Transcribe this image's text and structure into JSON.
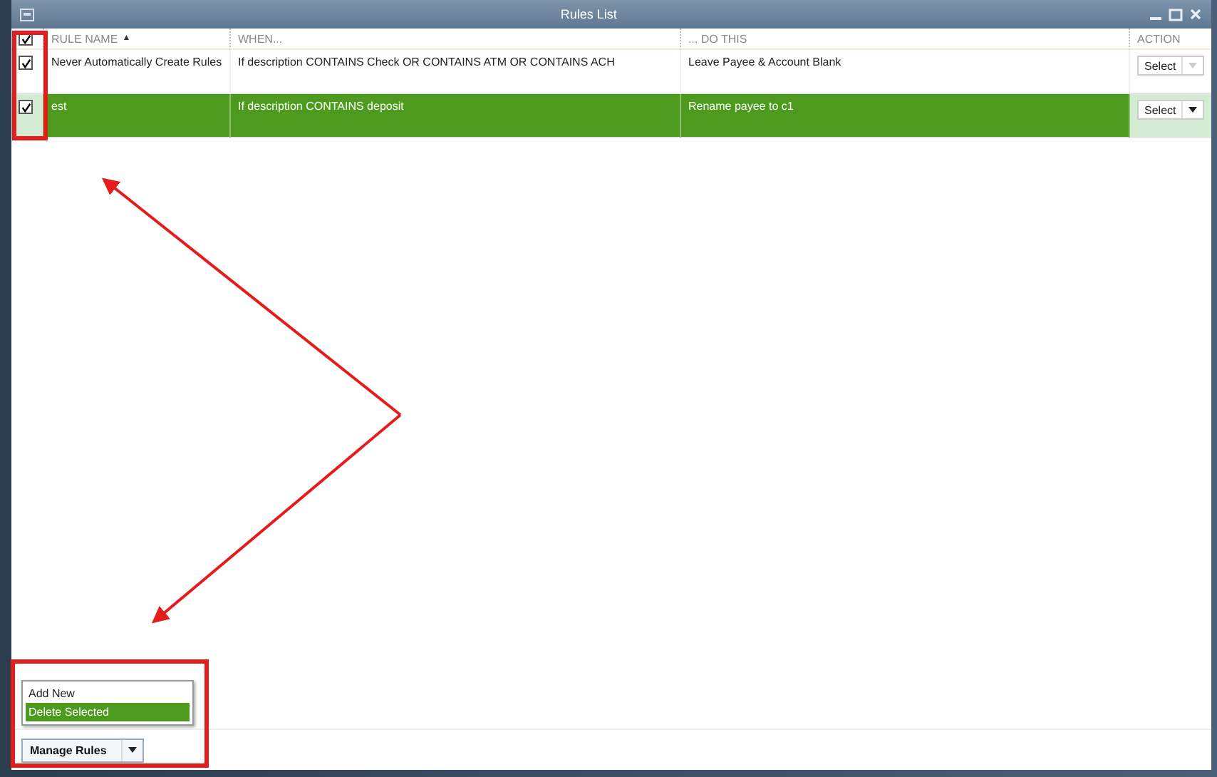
{
  "window": {
    "title": "Rules List"
  },
  "table": {
    "select_all": {
      "checked": true
    },
    "columns": [
      {
        "label": "RULE NAME",
        "sort_indicator": "▲"
      },
      {
        "label": "WHEN..."
      },
      {
        "label": "... DO THIS"
      },
      {
        "label": "ACTION"
      }
    ],
    "rows": [
      {
        "checked": true,
        "selected": false,
        "name": "Never Automatically Create Rules",
        "when": "If description  CONTAINS Check OR CONTAINS ATM OR CONTAINS ACH",
        "do_this": "Leave Payee & Account Blank",
        "action": "Select"
      },
      {
        "checked": true,
        "selected": true,
        "name": "est",
        "when": "If description  CONTAINS deposit",
        "do_this": "Rename payee to c1",
        "action": "Select"
      }
    ]
  },
  "menu": {
    "items": [
      {
        "label": "Add New",
        "selected": false
      },
      {
        "label": "Delete Selected",
        "selected": true
      }
    ]
  },
  "footer": {
    "button": "Manage Rules"
  }
}
